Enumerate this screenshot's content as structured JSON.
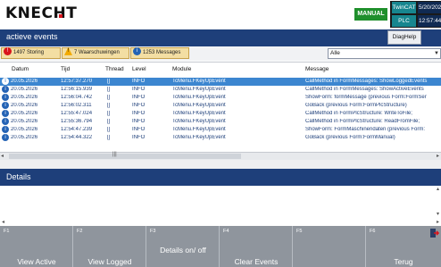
{
  "header": {
    "logo": "KNECHT",
    "mode": "MANUAL",
    "twincat": "TwinCAT",
    "plc": "PLC",
    "date": "5/20/2026",
    "time": "12:57:44",
    "accent_red": "#d9141c"
  },
  "title": "actieve events",
  "diaghelp": "DiagHelp",
  "filters": {
    "storing": "1497 Storing",
    "waarschuwingen": "7 Waarschuwingen",
    "messages": "1253 Messages",
    "select_value": "Alle"
  },
  "table": {
    "columns": [
      "Datum",
      "Tijd",
      "Thread",
      "Level",
      "Module",
      "Message"
    ],
    "rows": [
      {
        "datum": "20.05.2026",
        "tijd": "12:57:37.270",
        "thread": "[]",
        "level": "INFO",
        "module": "TcMenu.FKeyUpEvent",
        "message": "CallMethod in FormMessages: ShowLoggedEvents"
      },
      {
        "datum": "20.05.2026",
        "tijd": "12:56:15.939",
        "thread": "[]",
        "level": "INFO",
        "module": "TcMenu.FKeyUpEvent",
        "message": "CallMethod in FormMessages: ShowActiveEvents"
      },
      {
        "datum": "20.05.2026",
        "tijd": "12:56:04.742",
        "thread": "[]",
        "level": "INFO",
        "module": "TcMenu.FKeyUpEvent",
        "message": "ShowForm: formMessage (previous Form:FormSer"
      },
      {
        "datum": "20.05.2026",
        "tijd": "12:56:02.311",
        "thread": "[]",
        "level": "INFO",
        "module": "TcMenu.FKeyUpEvent",
        "message": "GoBack (previous Form:FormPlcStructure)"
      },
      {
        "datum": "20.05.2026",
        "tijd": "12:55:47.024",
        "thread": "[]",
        "level": "INFO",
        "module": "TcMenu.FKeyUpEvent",
        "message": "CallMethod in FormPlcStructure: WriteToFile;"
      },
      {
        "datum": "20.05.2026",
        "tijd": "12:55:36.794",
        "thread": "[]",
        "level": "INFO",
        "module": "TcMenu.FKeyUpEvent",
        "message": "CallMethod in FormPlcStructure: ReadFromFile;"
      },
      {
        "datum": "20.05.2026",
        "tijd": "12:54:47.239",
        "thread": "[]",
        "level": "INFO",
        "module": "TcMenu.FKeyUpEvent",
        "message": "ShowForm: FormMaschinendaten (previous Form:"
      },
      {
        "datum": "20.05.2026",
        "tijd": "12:54:44.322",
        "thread": "[]",
        "level": "INFO",
        "module": "TcMenu.FKeyUpEvent",
        "message": "GoBack (previous Form:FormManual)"
      }
    ]
  },
  "details_title": "Details",
  "fkeys": [
    {
      "num": "F1",
      "label": "View Active"
    },
    {
      "num": "F2",
      "label": "View Logged"
    },
    {
      "num": "F3",
      "label": "Details on/ off"
    },
    {
      "num": "F4",
      "label": "Clear Events"
    },
    {
      "num": "F5",
      "label": ""
    },
    {
      "num": "F6",
      "label": "Terug"
    }
  ]
}
